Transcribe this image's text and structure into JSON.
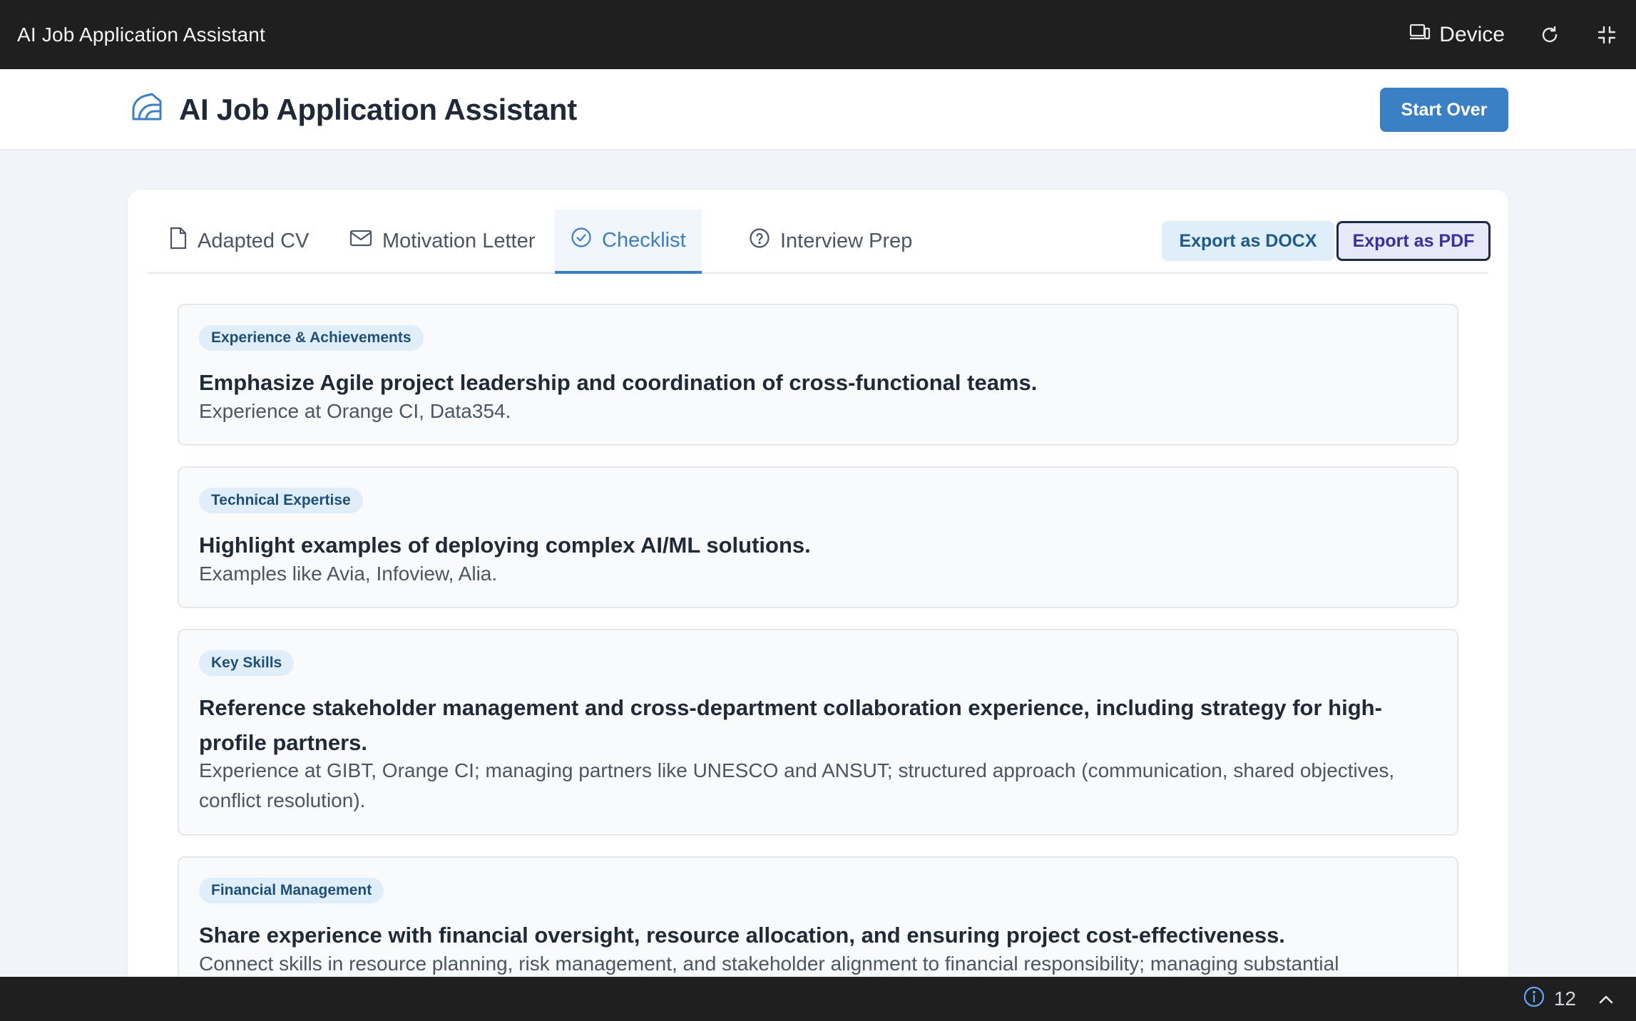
{
  "window": {
    "title": "AI Job Application Assistant",
    "device_label": "Device"
  },
  "header": {
    "title": "AI Job Application Assistant",
    "start_over_label": "Start Over"
  },
  "tabs": [
    {
      "label": "Adapted CV",
      "icon": "file-icon",
      "active": false
    },
    {
      "label": "Motivation Letter",
      "icon": "mail-icon",
      "active": false
    },
    {
      "label": "Checklist",
      "icon": "check-circle-icon",
      "active": true
    },
    {
      "label": "Interview Prep",
      "icon": "question-circle-icon",
      "active": false
    }
  ],
  "export": {
    "docx_label": "Export as DOCX",
    "pdf_label": "Export as PDF"
  },
  "checklist": [
    {
      "category": "Experience & Achievements",
      "title": "Emphasize Agile project leadership and coordination of cross-functional teams.",
      "detail": "Experience at Orange CI, Data354."
    },
    {
      "category": "Technical Expertise",
      "title": "Highlight examples of deploying complex AI/ML solutions.",
      "detail": "Examples like Avia, Infoview, Alia."
    },
    {
      "category": "Key Skills",
      "title": "Reference stakeholder management and cross-department collaboration experience, including strategy for high-profile partners.",
      "detail": "Experience at GIBT, Orange CI; managing partners like UNESCO and ANSUT; structured approach (communication, shared objectives, conflict resolution)."
    },
    {
      "category": "Financial Management",
      "title": "Share experience with financial oversight, resource allocation, and ensuring project cost-effectiveness.",
      "detail": "Connect skills in resource planning, risk management, and stakeholder alignment to financial responsibility; managing substantial"
    }
  ],
  "status": {
    "issues_count": "12"
  },
  "colors": {
    "accent": "#3b7fc4",
    "badge_bg": "#e0eef9",
    "chrome": "#1f1f1f",
    "page_bg": "#f1f5f9"
  }
}
